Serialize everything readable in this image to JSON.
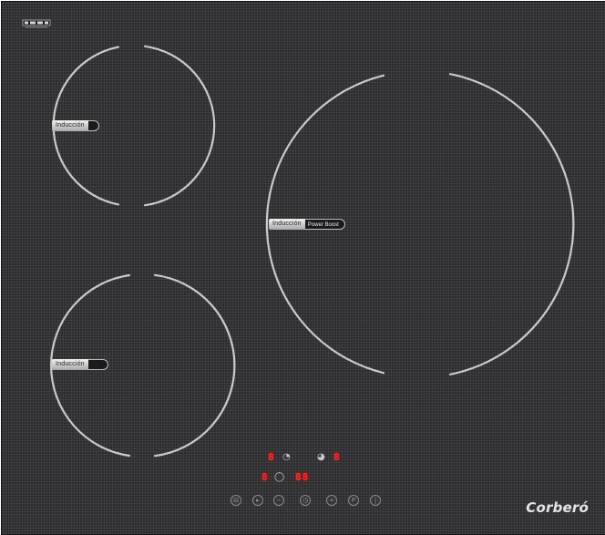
{
  "hob": {
    "zones": [
      {
        "name": "top-left",
        "label": "Inducción",
        "tail": ""
      },
      {
        "name": "bottom-left",
        "label": "Inducción",
        "tail": ""
      },
      {
        "name": "right-large",
        "label": "Inducción",
        "tail": "Power Boost"
      }
    ],
    "displays": {
      "zone_rear_left": "8",
      "zone_rear_right": "8",
      "zone_front": "8",
      "timer": "88"
    },
    "controls": [
      {
        "icon": "lock-icon",
        "glyph": "⊟"
      },
      {
        "icon": "power-icon",
        "glyph": "▸"
      },
      {
        "icon": "minus-icon",
        "glyph": "−"
      },
      {
        "icon": "timer-icon",
        "glyph": "◷"
      },
      {
        "icon": "plus-icon",
        "glyph": "+"
      },
      {
        "icon": "pause-icon",
        "glyph": "P"
      },
      {
        "icon": "onoff-icon",
        "glyph": "|"
      }
    ],
    "brand": "Corberó",
    "colors": {
      "glass": "#2b2b2d",
      "ring": "#c9c9cc",
      "display": "#ff2a2a"
    }
  }
}
